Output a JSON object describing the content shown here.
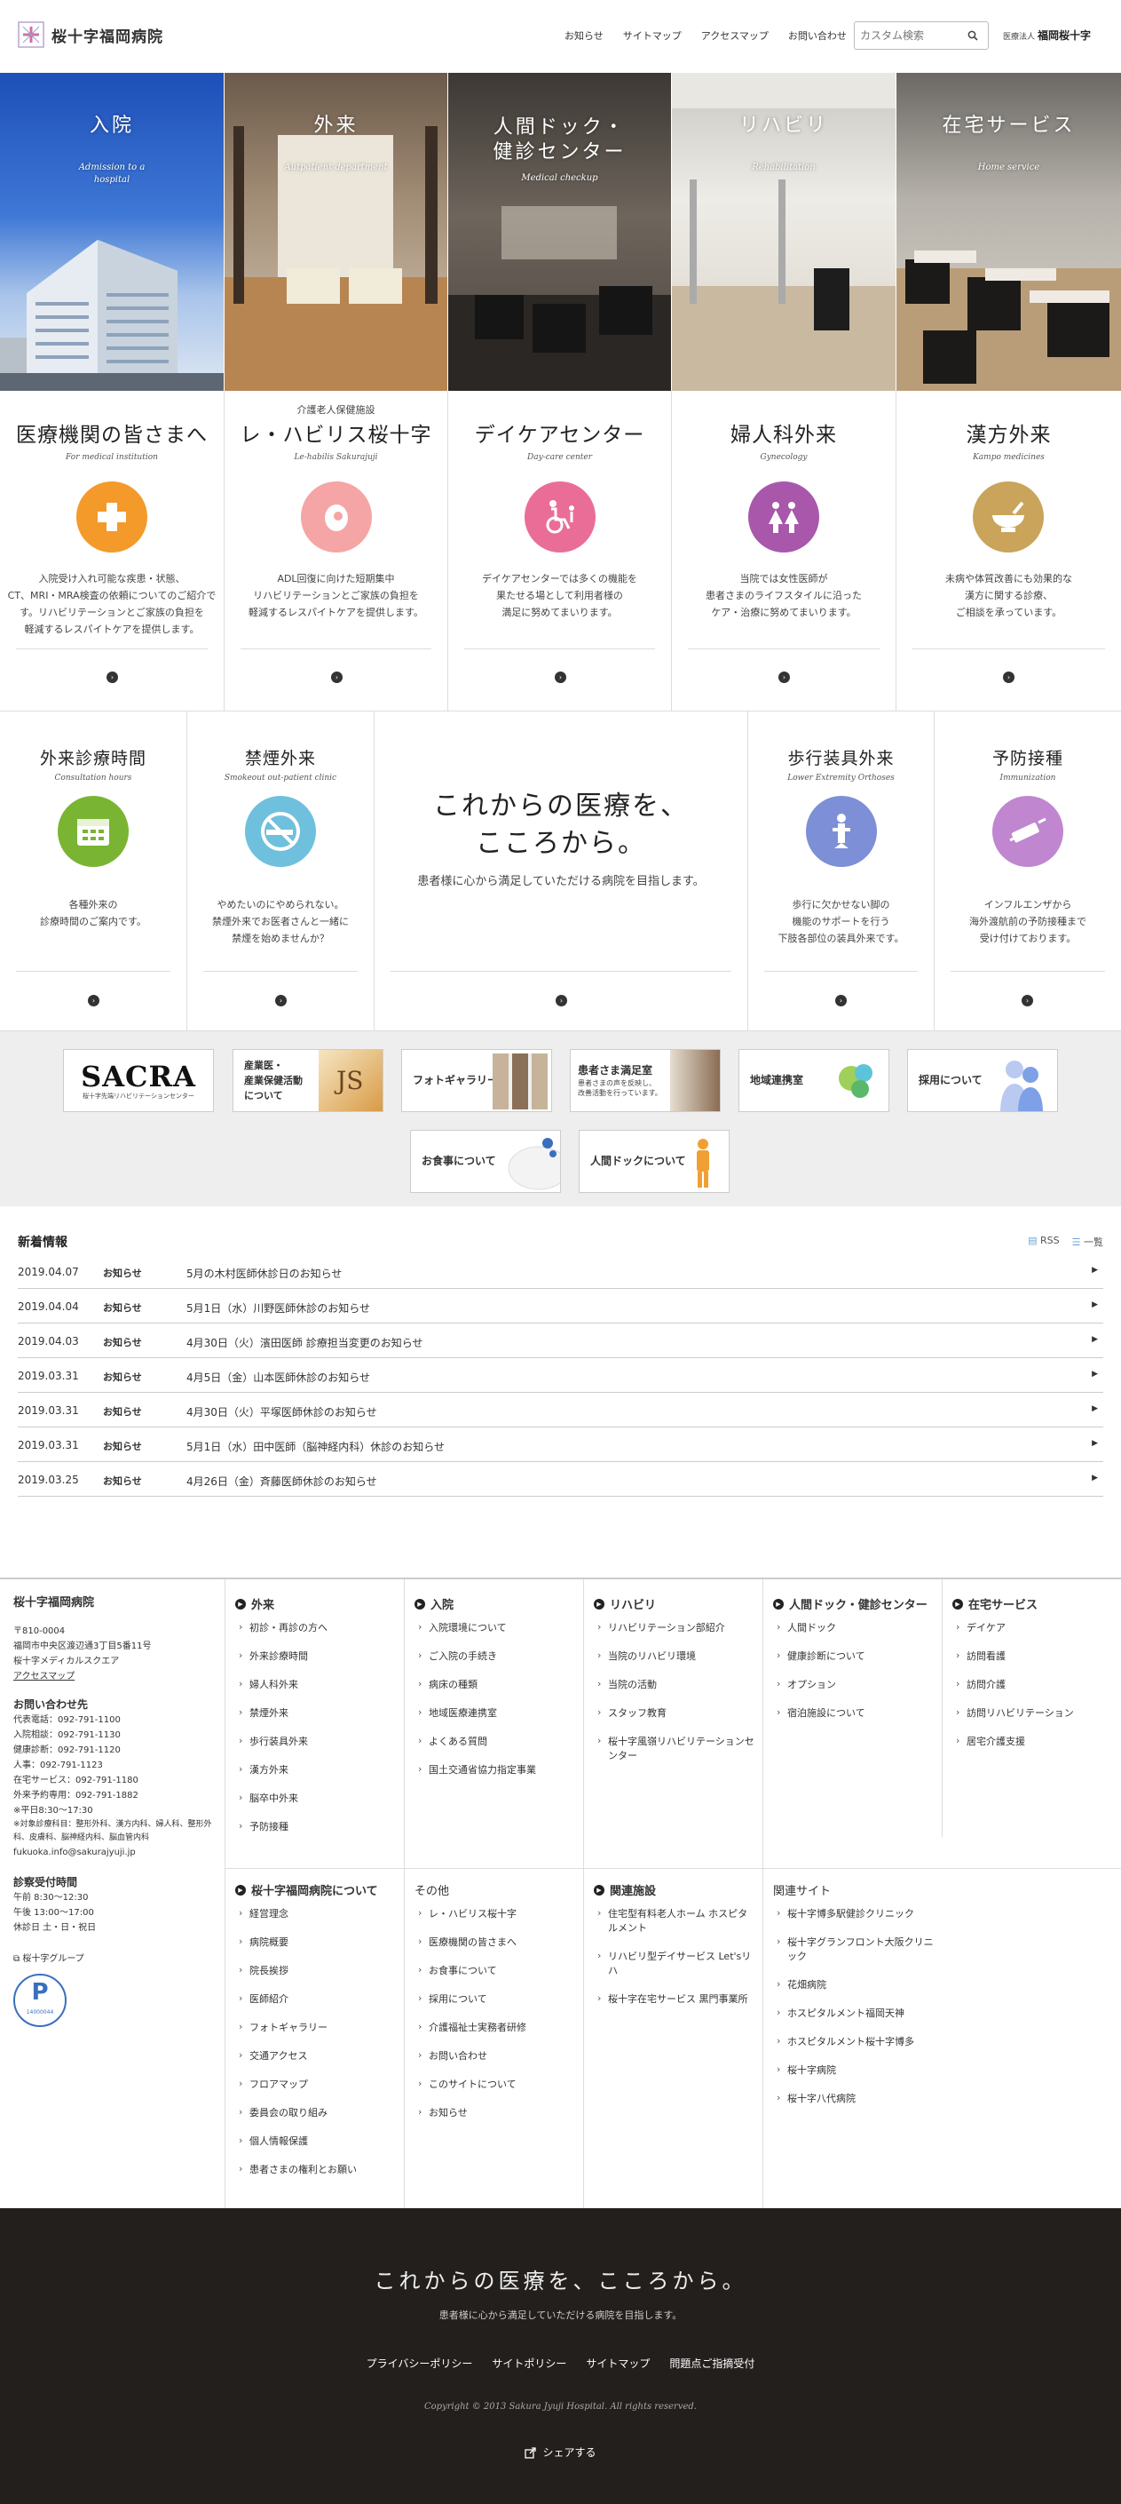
{
  "header": {
    "title": "桜十字福岡病院",
    "nav": [
      "お知らせ",
      "サイトマップ",
      "アクセスマップ",
      "お問い合わせ"
    ],
    "search_placeholder": "カスタム検索",
    "corp_prefix": "医療法人",
    "corp_name": "福岡桜十字"
  },
  "hero": [
    {
      "label": "入院",
      "en": "Admission to a\nhospital"
    },
    {
      "label": "外来",
      "en": "Autpatient department"
    },
    {
      "label": "人間ドック・\n健診センター",
      "en": "Medical checkup"
    },
    {
      "label": "リハビリ",
      "en": "Rehabilitation"
    },
    {
      "label": "在宅サービス",
      "en": "Home service"
    }
  ],
  "row1": [
    {
      "sub": "",
      "title": "医療機関の皆さまへ",
      "en": "For medical institution",
      "icon": "cross-icon",
      "color": "#f39a2a",
      "desc": "入院受け入れ可能な疾患・状態、\nCT、MRI・MRA検査の依頼についてのご紹介です。リハビリテーションとご家族の負担を\n軽減するレスパイトケアを提供します。"
    },
    {
      "sub": "介護老人保健施設",
      "title": "レ・ハビリス桜十字",
      "en": "Le-habilis Sakurajuji",
      "icon": "face-icon",
      "color": "#f5a5a5",
      "desc": "ADL回復に向けた短期集中\nリハビリテーションとご家族の負担を\n軽減するレスパイトケアを提供します。"
    },
    {
      "sub": "",
      "title": "デイケアセンター",
      "en": "Day-care center",
      "icon": "wheelchair-icon",
      "color": "#ea6d97",
      "desc": "デイケアセンターでは多くの機能を\n果たせる場として利用者様の\n満足に努めてまいります。"
    },
    {
      "sub": "",
      "title": "婦人科外来",
      "en": "Gynecology",
      "icon": "women-icon",
      "color": "#a857ab",
      "desc": "当院では女性医師が\n患者さまのライフスタイルに沿った\nケア・治療に努めてまいります。"
    },
    {
      "sub": "",
      "title": "漢方外来",
      "en": "Kampo medicines",
      "icon": "mortar-icon",
      "color": "#c9a45a",
      "desc": "未病や体質改善にも効果的な\n漢方に関する診療、\nご相談を承っています。"
    }
  ],
  "row2": [
    {
      "title": "外来診療時間",
      "en": "Consultation hours",
      "icon": "calendar-icon",
      "color": "#7ab433",
      "desc": "各種外来の\n診療時間のご案内です。"
    },
    {
      "title": "禁煙外来",
      "en": "Smokeout out-patient clinic",
      "icon": "no-smoking-icon",
      "color": "#6fc0dc",
      "desc": "やめたいのにやめられない。\n禁煙外来でお医者さんと一緒に\n禁煙を始めませんか？"
    },
    {
      "title": "歩行装具外来",
      "en": "Lower Extremity Orthoses",
      "icon": "orthosis-icon",
      "color": "#7d8fd6",
      "desc": "歩行に欠かせない脚の\n機能のサポートを行う\n下肢各部位の装具外来です。"
    },
    {
      "title": "予防接種",
      "en": "Immunization",
      "icon": "syringe-icon",
      "color": "#c086d0",
      "desc": "インフルエンザから\n海外渡航前の予防接種まで\n受け付けております。"
    }
  ],
  "center": {
    "title": "これからの医療を、\nこころから。",
    "desc": "患者様に心から満足していただける病院を目指します。"
  },
  "banners": [
    {
      "label": "SACRA",
      "sub": "桜十字先端リハビリテーションセンター"
    },
    {
      "label": "産業医・\n産業保健活動\nについて"
    },
    {
      "label": "フォトギャラリー"
    },
    {
      "label": "患者さま満足室",
      "sub": "患者さまの声を反映し、\n改善活動を行っています。"
    },
    {
      "label": "地域連携室"
    },
    {
      "label": "採用について"
    },
    {
      "label": "お食事について"
    },
    {
      "label": "人間ドックについて"
    }
  ],
  "news": {
    "heading": "新着情報",
    "rss": "RSS",
    "list_link": "一覧",
    "items": [
      {
        "date": "2019.04.07",
        "cat": "お知らせ",
        "text": "5月の木村医師休診日のお知らせ"
      },
      {
        "date": "2019.04.04",
        "cat": "お知らせ",
        "text": "5月1日（水）川野医師休診のお知らせ"
      },
      {
        "date": "2019.04.03",
        "cat": "お知らせ",
        "text": "4月30日（火）濱田医師 診療担当変更のお知らせ"
      },
      {
        "date": "2019.03.31",
        "cat": "お知らせ",
        "text": "4月5日（金）山本医師休診のお知らせ"
      },
      {
        "date": "2019.03.31",
        "cat": "お知らせ",
        "text": "4月30日（火）平塚医師休診のお知らせ"
      },
      {
        "date": "2019.03.31",
        "cat": "お知らせ",
        "text": "5月1日（水）田中医師（脳神経内科）休診のお知らせ"
      },
      {
        "date": "2019.03.25",
        "cat": "お知らせ",
        "text": "4月26日（金）斉藤医師休診のお知らせ"
      }
    ]
  },
  "footer_info": {
    "name": "桜十字福岡病院",
    "address": [
      "〒810-0004",
      "福岡市中央区渡辺通3丁目5番11号",
      "桜十字メディカルスクエア"
    ],
    "access": "アクセスマップ",
    "contact_head": "お問い合わせ先",
    "contacts": [
      "代表電話：092-791-1100",
      "入院相談：092-791-1130",
      "健康診断：092-791-1120",
      "人事：092-791-1123",
      "在宅サービス：092-791-1180",
      "外来予約専用：092-791-1882",
      "※平日8:30〜17:30",
      "※対象診療科目：整形外科、漢方内科、婦人科、整形外科、皮膚科、脳神経内科、脳血管内科",
      "fukuoka.info@sakurajyuji.jp"
    ],
    "hours_head": "診察受付時間",
    "hours": [
      "午前 8:30〜12:30",
      "午後 13:00〜17:00",
      "休診日 土・日・祝日"
    ],
    "group": "桜十字グループ",
    "badge": "14000044"
  },
  "footer_cols": [
    {
      "head": "外来",
      "items": [
        "初診・再診の方へ",
        "外来診療時間",
        "婦人科外来",
        "禁煙外来",
        "歩行装具外来",
        "漢方外来",
        "脳卒中外来",
        "予防接種"
      ]
    },
    {
      "head": "入院",
      "items": [
        "入院環境について",
        "ご入院の手続き",
        "病床の種類",
        "地域医療連携室",
        "よくある質問",
        "国土交通省協力指定事業"
      ]
    },
    {
      "head": "リハビリ",
      "items": [
        "リハビリテーション部紹介",
        "当院のリハビリ環境",
        "当院の活動",
        "スタッフ教育",
        "桜十字風嶺リハビリテーションセンター"
      ]
    },
    {
      "head": "人間ドック・健診センター",
      "items": [
        "人間ドック",
        "健康診断について",
        "オプション",
        "宿泊施設について"
      ]
    },
    {
      "head": "在宅サービス",
      "items": [
        "デイケア",
        "訪問看護",
        "訪問介護",
        "訪問リハビリテーション",
        "居宅介護支援"
      ]
    },
    {
      "head": "桜十字福岡病院について",
      "items": [
        "経営理念",
        "病院概要",
        "院長挨拶",
        "医師紹介",
        "フォトギャラリー",
        "交通アクセス",
        "フロアマップ",
        "委員会の取り組み",
        "個人情報保護",
        "患者さまの権利とお願い"
      ]
    },
    {
      "head": "その他",
      "items": [
        "レ・ハビリス桜十字",
        "医療機関の皆さまへ",
        "お食事について",
        "採用について",
        "介護福祉士実務者研修",
        "お問い合わせ",
        "このサイトについて",
        "お知らせ"
      ]
    },
    {
      "head": "関連施設",
      "items": [
        "住宅型有料老人ホーム ホスピタルメント",
        "リハビリ型デイサービス Let'sリハ",
        "桜十字在宅サービス 黒門事業所"
      ]
    },
    {
      "head": "関連サイト",
      "items": [
        "桜十字博多駅健診クリニック",
        "桜十字グランフロント大阪クリニック",
        "花畑病院",
        "ホスピタルメント福岡天神",
        "ホスピタルメント桜十字博多",
        "桜十字病院",
        "桜十字八代病院"
      ]
    }
  ],
  "bottom": {
    "slogan": "これからの医療を、こころから。",
    "sub": "患者様に心から満足していただける病院を目指します。",
    "links": [
      "プライバシーポリシー",
      "サイトポリシー",
      "サイトマップ",
      "問題点ご指摘受付"
    ],
    "copyright": "Copyright © 2013 Sakura Jyuji Hospital. All rights reserved.",
    "share": "シェアする"
  },
  "colors": {
    "dark_footer": "#231f1d"
  }
}
